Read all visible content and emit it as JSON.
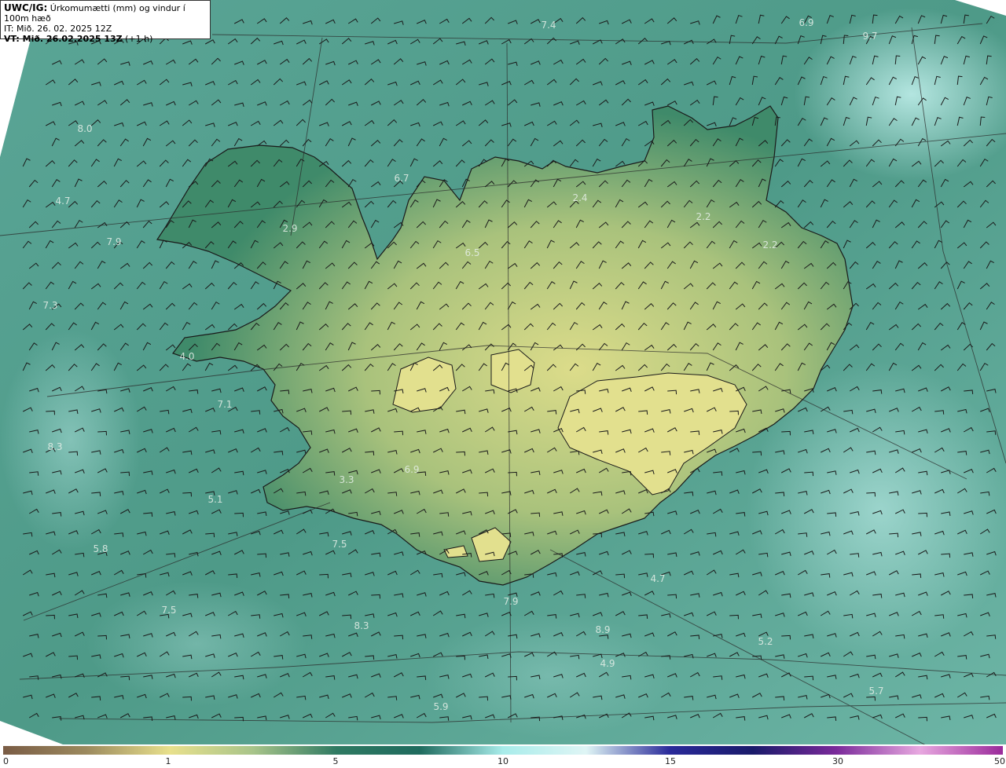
{
  "header": {
    "model": "UWC/IG:",
    "title": "Úrkomumætti (mm) og vindur í 100m hæð",
    "init_label": "IT: Mið. 26. 02. 2025 12Z",
    "valid_bold": "VT: Mið. 26.02.2025 13Z",
    "valid_lead": "(+1 h)"
  },
  "value_labels": [
    "7.4",
    "6.9",
    "9.7",
    "8.0",
    "4.7",
    "7.9",
    "7.3",
    "4.0",
    "7.1",
    "8.3",
    "5.1",
    "5.8",
    "7.5",
    "7.5",
    "8.3",
    "7.9",
    "8.9",
    "4.9",
    "5.2",
    "5.7",
    "5.9",
    "6.7",
    "2.9",
    "6.5",
    "2.4",
    "2.2",
    "2.2",
    "3.3",
    "6.9",
    "4.7"
  ],
  "colorbar": {
    "ticks": [
      "0",
      "1",
      "5",
      "10",
      "15",
      "30",
      "50"
    ],
    "stops": [
      "#7a5c45",
      "#9c8a5e",
      "#e8e08c",
      "#a8c48a",
      "#2f7a62",
      "#1f6b5e",
      "#a8ecea",
      "#dff5f5",
      "#2a2a9a",
      "#1a1a6a",
      "#7a2a9a",
      "#e8a8e0",
      "#9a2a9a"
    ]
  },
  "colors": {
    "ocean": "#4e9a88",
    "land_low": "#3f8a6a",
    "land_high": "#d8d888",
    "outline": "#1a1a1a",
    "barb": "#1a1a1a"
  }
}
